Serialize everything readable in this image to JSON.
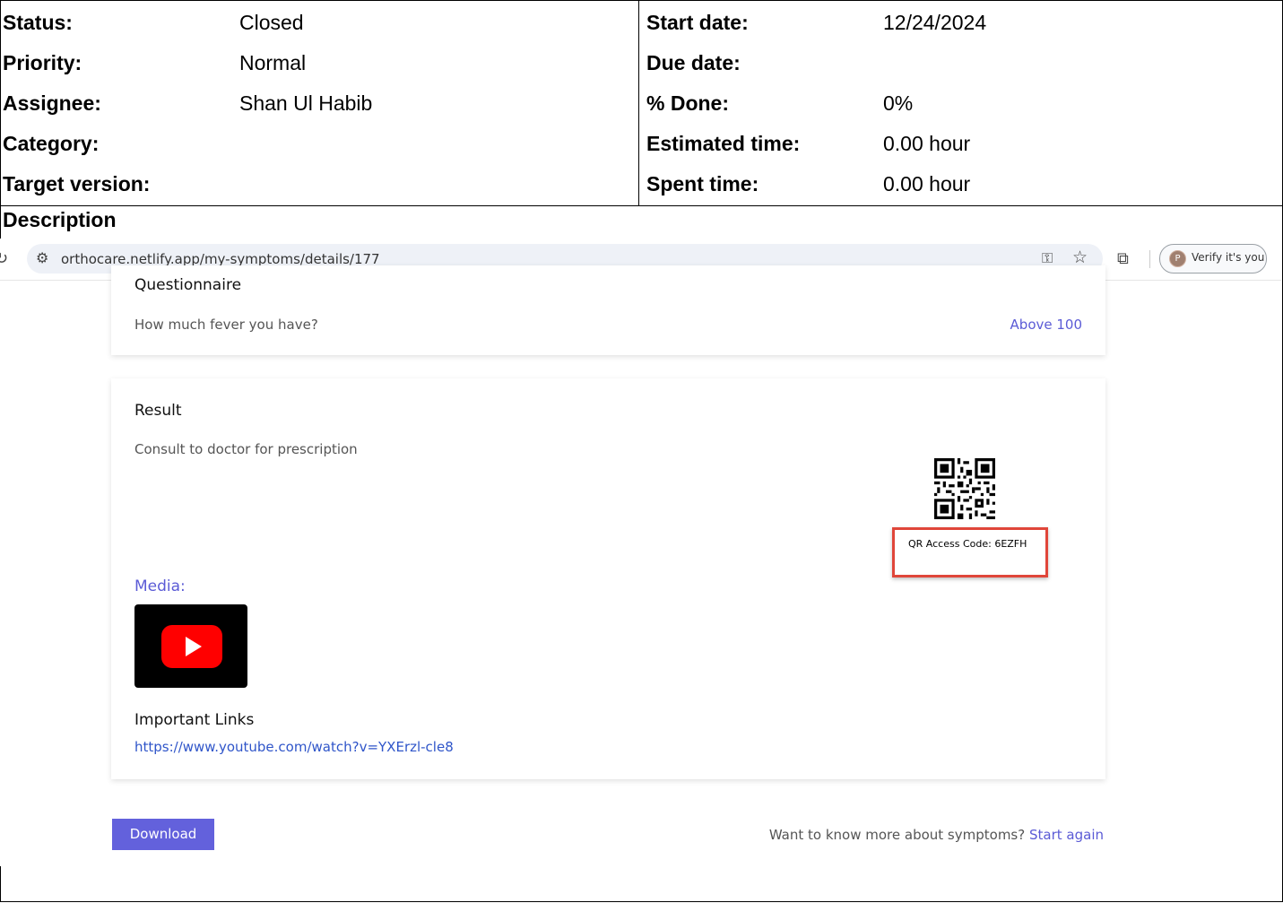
{
  "attributes": {
    "left": [
      {
        "label": "Status:",
        "value": "Closed"
      },
      {
        "label": "Priority:",
        "value": "Normal"
      },
      {
        "label": "Assignee:",
        "value": "Shan Ul Habib"
      },
      {
        "label": "Category:",
        "value": ""
      },
      {
        "label": "Target version:",
        "value": ""
      }
    ],
    "right": [
      {
        "label": "Start date:",
        "value": "12/24/2024"
      },
      {
        "label": "Due date:",
        "value": ""
      },
      {
        "label": "% Done:",
        "value": "0%"
      },
      {
        "label": "Estimated time:",
        "value": "0.00 hour"
      },
      {
        "label": "Spent time:",
        "value": "0.00 hour"
      }
    ]
  },
  "description": {
    "title": "Description"
  },
  "screenshot": {
    "browser": {
      "url": "orthocare.netlify.app/my-symptoms/details/177",
      "verify_label": "Verify it's you",
      "avatar_letter": "P"
    },
    "questionnaire": {
      "heading": "Questionnaire",
      "question": "How much fever you have?",
      "answer": "Above 100"
    },
    "result": {
      "heading": "Result",
      "text": "Consult to doctor for prescription",
      "qr_access_code": "QR Access Code: 6EZFH",
      "media_label": "Media:",
      "important_links_heading": "Important Links",
      "link": "https://www.youtube.com/watch?v=YXErzl-cle8"
    },
    "footer": {
      "download_label": "Download",
      "more_text": "Want to know more about symptoms?",
      "start_again_label": "Start again"
    },
    "colors": {
      "accent": "#5b5bd6",
      "button": "#6361dc",
      "highlight_box": "#e0463a",
      "link": "#2f55c9"
    },
    "icons": [
      "reload-icon",
      "tune-icon",
      "key-icon",
      "star-icon",
      "extensions-icon",
      "youtube-play-icon",
      "qr-code-icon"
    ]
  }
}
